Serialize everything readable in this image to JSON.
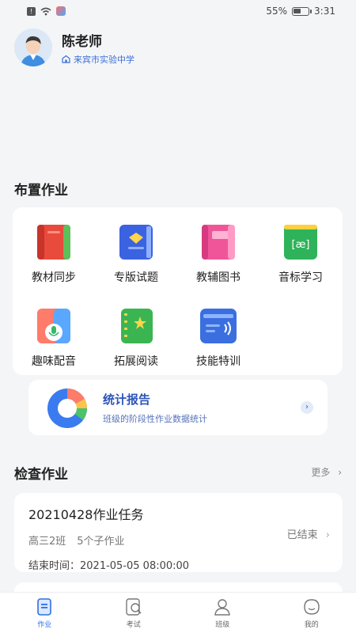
{
  "status_bar": {
    "battery": "55%",
    "time": "3:31",
    "battery_level": 0.55
  },
  "profile": {
    "name": "陈老师",
    "school": "来宾市实验中学"
  },
  "assign_section": {
    "title": "布置作业",
    "items": [
      {
        "label": "教材同步",
        "icon": "textbook-icon"
      },
      {
        "label": "专版试题",
        "icon": "exam-book-icon"
      },
      {
        "label": "教辅图书",
        "icon": "reference-book-icon"
      },
      {
        "label": "音标学习",
        "icon": "phonetic-book-icon",
        "icon_text": "[æ]"
      },
      {
        "label": "趣味配音",
        "icon": "dubbing-microphone-icon"
      },
      {
        "label": "拓展阅读",
        "icon": "reading-notebook-icon"
      },
      {
        "label": "技能特训",
        "icon": "skill-training-icon"
      }
    ]
  },
  "stats": {
    "title": "统计报告",
    "subtitle": "班级的阶段性作业数据统计"
  },
  "check_section": {
    "title": "检查作业",
    "more": "更多"
  },
  "task": {
    "title": "20210428作业任务",
    "class": "高三2班",
    "subtasks": "5个子作业",
    "end_time": "结束时间：2021-05-05 08:00:00",
    "status": "已结束"
  },
  "tabbar": [
    {
      "label": "作业",
      "icon": "homework-tab-icon",
      "active": true
    },
    {
      "label": "考试",
      "icon": "exam-tab-icon",
      "active": false
    },
    {
      "label": "班级",
      "icon": "class-tab-icon",
      "active": false
    },
    {
      "label": "我的",
      "icon": "profile-tab-icon",
      "active": false
    }
  ],
  "colors": {
    "accent": "#2d6fe8",
    "stats_title": "#2d55b8",
    "background": "#f4f5f7"
  }
}
